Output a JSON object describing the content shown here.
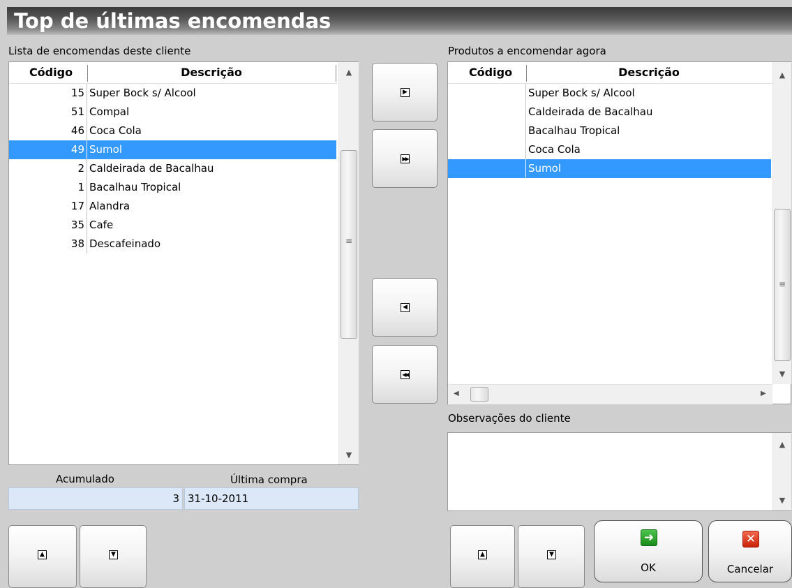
{
  "window": {
    "title": "Top de últimas encomendas"
  },
  "left_list": {
    "label": "Lista de encomendas deste cliente",
    "headers": {
      "code": "Código",
      "desc": "Descrição"
    },
    "rows": [
      {
        "code": "15",
        "desc": "Super Bock s/ Alcool"
      },
      {
        "code": "51",
        "desc": "Compal"
      },
      {
        "code": "46",
        "desc": "Coca Cola"
      },
      {
        "code": "49",
        "desc": "Sumol",
        "selected": true
      },
      {
        "code": "2",
        "desc": "Caldeirada de Bacalhau"
      },
      {
        "code": "1",
        "desc": "Bacalhau Tropical"
      },
      {
        "code": "17",
        "desc": "Alandra"
      },
      {
        "code": "35",
        "desc": "Cafe"
      },
      {
        "code": "38",
        "desc": "Descafeinado"
      }
    ]
  },
  "summary": {
    "acumulado_label": "Acumulado",
    "ultima_label": "Última compra",
    "acumulado_value": "3",
    "ultima_value": "31-10-2011"
  },
  "right_list": {
    "label": "Produtos a encomendar agora",
    "headers": {
      "code": "Código",
      "desc": "Descrição"
    },
    "rows": [
      {
        "code": "",
        "desc": "Super Bock s/ Alcool"
      },
      {
        "code": "",
        "desc": "Caldeirada de Bacalhau"
      },
      {
        "code": "",
        "desc": "Bacalhau Tropical"
      },
      {
        "code": "",
        "desc": "Coca Cola"
      },
      {
        "code": "",
        "desc": "Sumol",
        "selected": true
      }
    ]
  },
  "notes": {
    "label": "Observações do cliente",
    "value": ""
  },
  "buttons": {
    "ok": "OK",
    "cancel": "Cancelar"
  },
  "icons": {
    "move_right": "play-right-icon",
    "move_all_right": "fast-forward-icon",
    "move_left": "play-left-icon",
    "move_all_left": "rewind-icon",
    "up": "arrow-up-icon",
    "down": "arrow-down-icon",
    "ok": "arrow-right-icon",
    "cancel": "close-icon"
  },
  "colors": {
    "selection": "#3399ff",
    "value_box": "#dce8f8"
  }
}
